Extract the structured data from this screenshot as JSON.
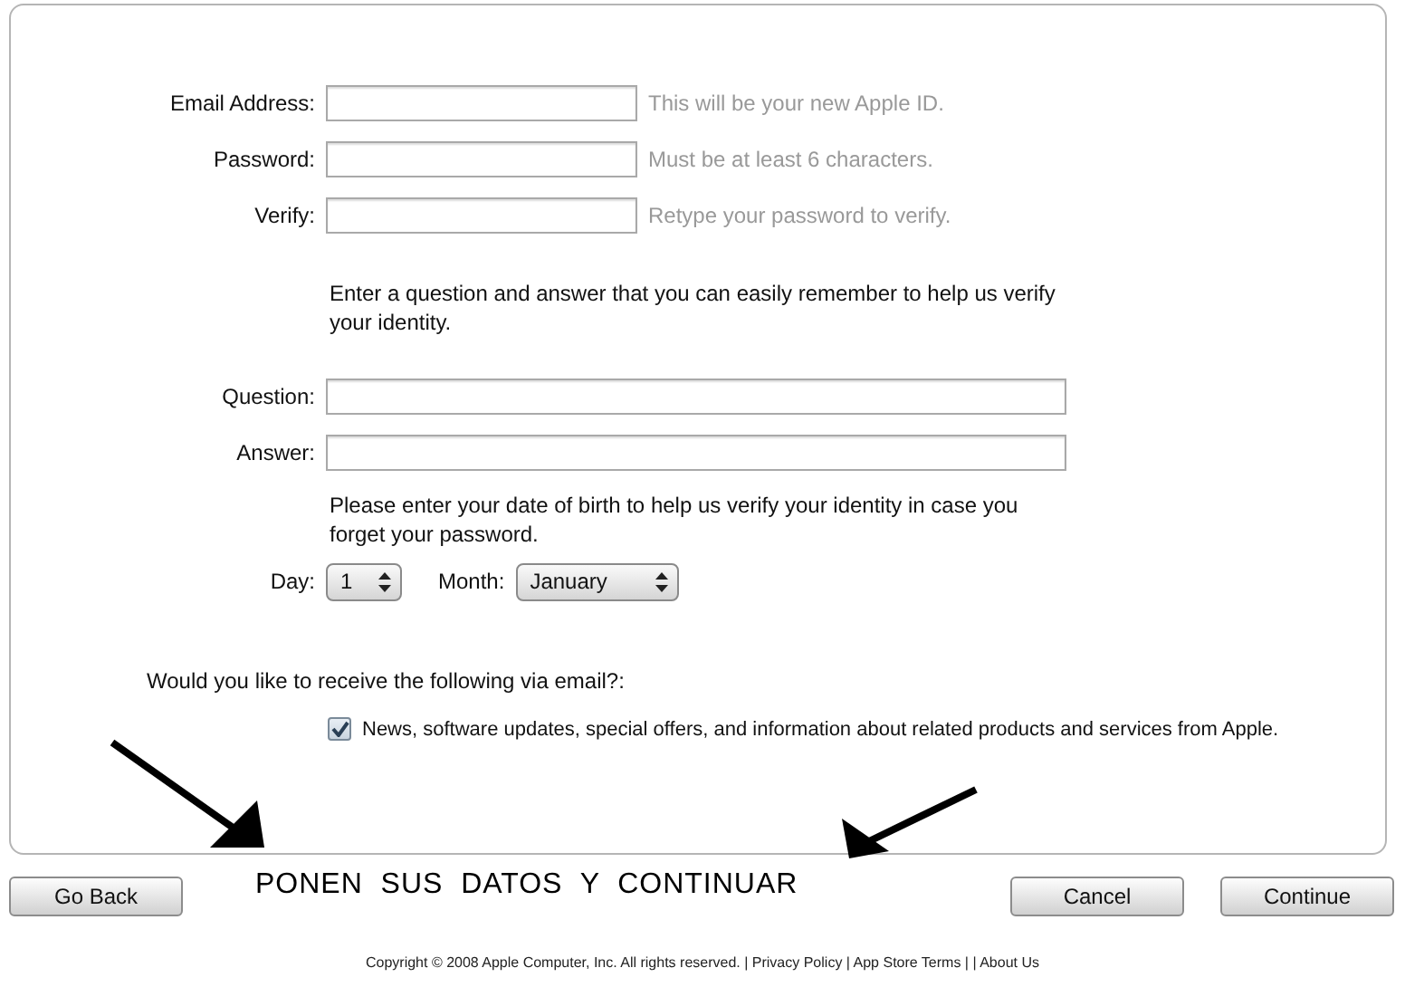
{
  "account_fields": [
    {
      "label": "Email Address:",
      "hint": "This will be your new Apple ID."
    },
    {
      "label": "Password:",
      "hint": "Must be at least 6 characters."
    },
    {
      "label": "Verify:",
      "hint": "Retype your password to verify."
    }
  ],
  "security_intro": "Enter a question and answer that you can easily remember to help us verify your identity.",
  "security_fields": [
    {
      "label": "Question:"
    },
    {
      "label": "Answer:"
    }
  ],
  "birth_intro": "Please enter your date of birth to help us verify your identity in case you forget your password.",
  "birth_selects": [
    {
      "label": "Day:",
      "value": "1",
      "kind": "narrow"
    },
    {
      "label": "Month:",
      "value": "January",
      "kind": "wide"
    }
  ],
  "newsletter": {
    "prompt": "Would you like to receive the following via email?:",
    "option": "News, software updates, special offers, and information about related products and services from Apple.",
    "checked": true
  },
  "buttons": {
    "back": "Go Back",
    "cancel": "Cancel",
    "continue": "Continue"
  },
  "annotation": "PONEN  SUS  DATOS  Y  CONTINUAR",
  "footer": "Copyright © 2008 Apple Computer, Inc. All rights reserved. | Privacy Policy | App Store Terms | | About Us"
}
